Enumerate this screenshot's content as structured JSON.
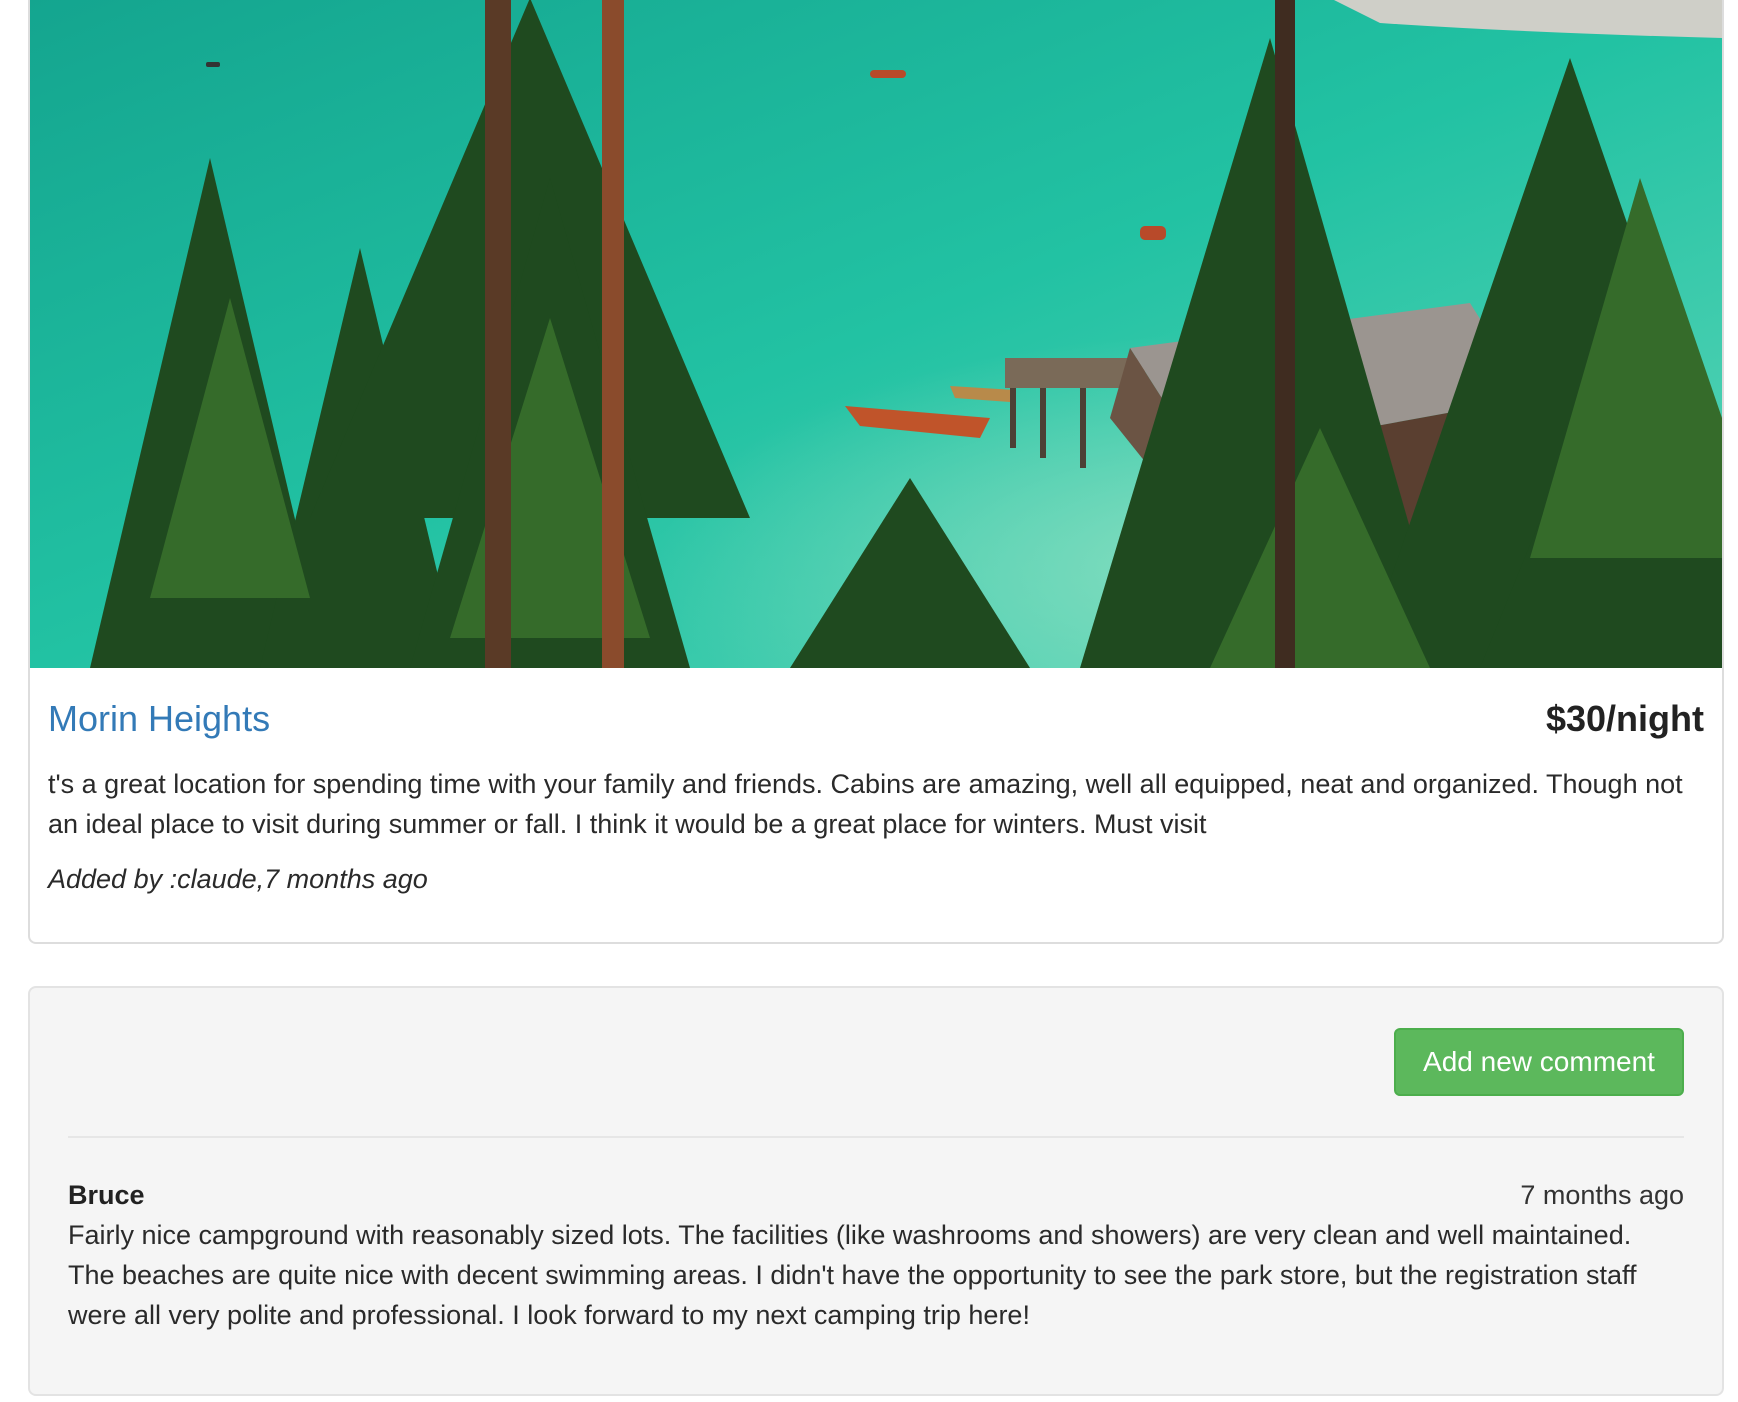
{
  "campground": {
    "name": "Morin Heights",
    "price": "$30/night",
    "description": "t's a great location for spending time with your family and friends. Cabins are amazing, well all equipped, neat and organized. Though not an ideal place to visit during summer or fall. I think it would be a great place for winters. Must visit",
    "added_by": "Added by :claude,7 months ago"
  },
  "comments_section": {
    "add_button_label": "Add new comment",
    "comments": [
      {
        "author": "Bruce",
        "time": "7 months ago",
        "text": "Fairly nice campground with reasonably sized lots. The facilities (like washrooms and showers) are very clean and well maintained. The beaches are quite nice with decent swimming areas. I didn't have the opportunity to see the park store, but the registration staff were all very polite and professional. I look forward to my next camping trip here!"
      }
    ]
  },
  "colors": {
    "link": "#337ab7",
    "success": "#5cb85c",
    "water": "#1fb39a"
  }
}
